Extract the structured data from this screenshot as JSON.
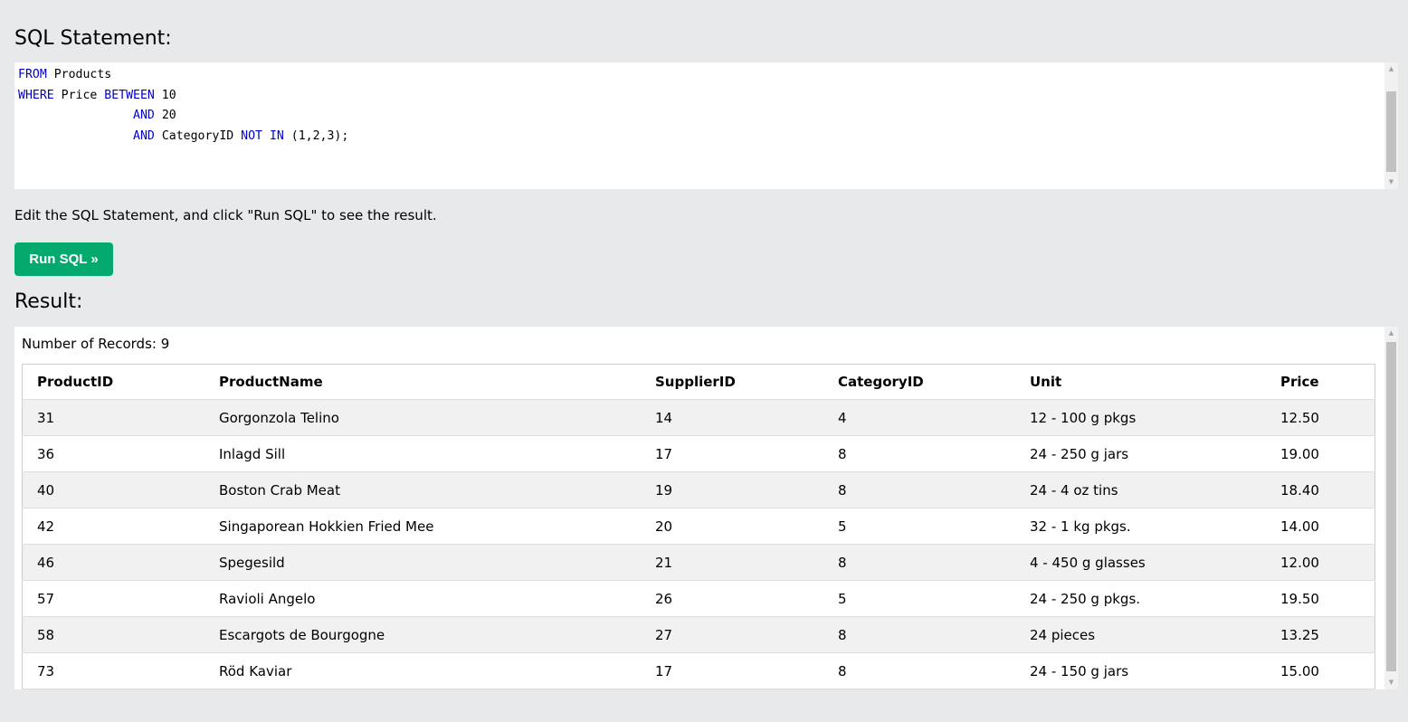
{
  "sql_heading": "SQL Statement:",
  "sql_lines": [
    [
      {
        "t": "FROM",
        "kw": true
      },
      {
        "t": " Products",
        "kw": false
      }
    ],
    [
      {
        "t": "WHERE",
        "kw": true
      },
      {
        "t": " Price ",
        "kw": false
      },
      {
        "t": "BETWEEN",
        "kw": true
      },
      {
        "t": " 10",
        "kw": false
      }
    ],
    [
      {
        "t": "                ",
        "kw": false
      },
      {
        "t": "AND",
        "kw": true
      },
      {
        "t": " 20",
        "kw": false
      }
    ],
    [
      {
        "t": "                ",
        "kw": false
      },
      {
        "t": "AND",
        "kw": true
      },
      {
        "t": " CategoryID ",
        "kw": false
      },
      {
        "t": "NOT",
        "kw": true
      },
      {
        "t": " ",
        "kw": false
      },
      {
        "t": "IN",
        "kw": true
      },
      {
        "t": " (1,2,3);",
        "kw": false
      }
    ]
  ],
  "hint": "Edit the SQL Statement, and click \"Run SQL\" to see the result.",
  "run_button": "Run SQL »",
  "result_heading": "Result:",
  "record_count": "Number of Records: 9",
  "table": {
    "headers": [
      "ProductID",
      "ProductName",
      "SupplierID",
      "CategoryID",
      "Unit",
      "Price"
    ],
    "rows": [
      [
        "31",
        "Gorgonzola Telino",
        "14",
        "4",
        "12 - 100 g pkgs",
        "12.50"
      ],
      [
        "36",
        "Inlagd Sill",
        "17",
        "8",
        "24 - 250 g jars",
        "19.00"
      ],
      [
        "40",
        "Boston Crab Meat",
        "19",
        "8",
        "24 - 4 oz tins",
        "18.40"
      ],
      [
        "42",
        "Singaporean Hokkien Fried Mee",
        "20",
        "5",
        "32 - 1 kg pkgs.",
        "14.00"
      ],
      [
        "46",
        "Spegesild",
        "21",
        "8",
        "4 - 450 g glasses",
        "12.00"
      ],
      [
        "57",
        "Ravioli Angelo",
        "26",
        "5",
        "24 - 250 g pkgs.",
        "19.50"
      ],
      [
        "58",
        "Escargots de Bourgogne",
        "27",
        "8",
        "24 pieces",
        "13.25"
      ],
      [
        "73",
        "Röd Kaviar",
        "17",
        "8",
        "24 - 150 g jars",
        "15.00"
      ]
    ]
  },
  "colors": {
    "background": "#e7e9eb",
    "run_button": "#04aa6d",
    "keyword": "#0000cd"
  },
  "icons": {
    "scroll_up": "scroll-up-arrow-icon",
    "scroll_down": "scroll-down-arrow-icon"
  }
}
